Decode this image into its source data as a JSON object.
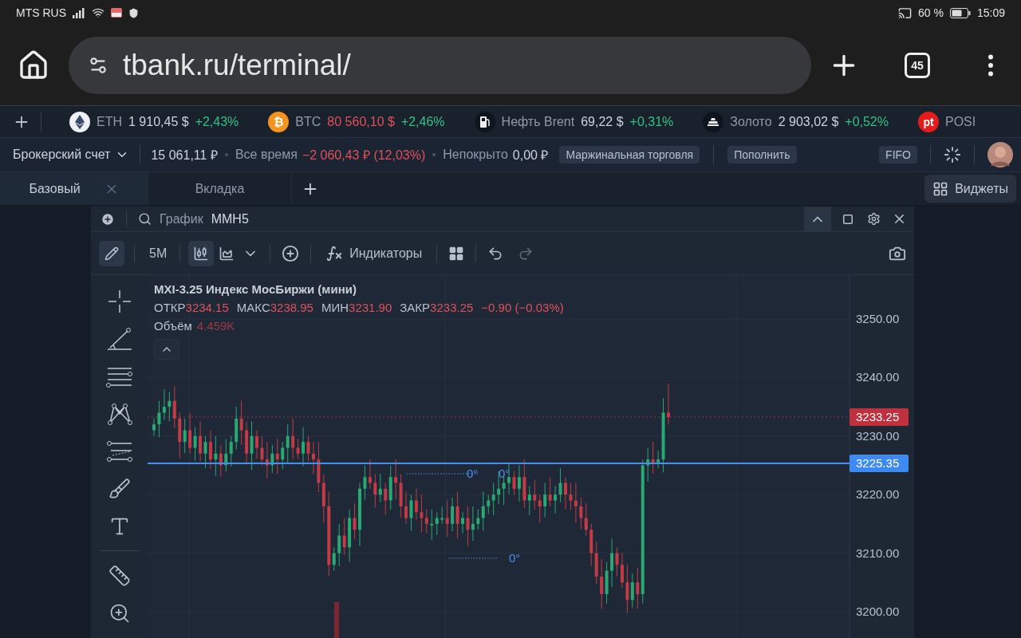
{
  "status_bar": {
    "carrier": "MTS RUS",
    "battery": "60 %",
    "time": "15:09"
  },
  "browser": {
    "url": "tbank.ru/terminal/",
    "tab_count": "45"
  },
  "ticker": [
    {
      "kind": "eth",
      "name": "ETH",
      "price": "1 910,45 $",
      "price_down": false,
      "change": "+2,43%"
    },
    {
      "kind": "btc",
      "logo_text": "₿",
      "name": "BTC",
      "price": "80 560,10 $",
      "price_down": true,
      "change": "+2,46%"
    },
    {
      "kind": "oil",
      "name": "Нефть Brent",
      "price": "69,22 $",
      "price_down": false,
      "change": "+0,31%"
    },
    {
      "kind": "gold",
      "name": "Золото",
      "price": "2 903,02 $",
      "price_down": false,
      "change": "+0,52%"
    },
    {
      "kind": "posi",
      "logo_text": "pt",
      "name": "POSI"
    }
  ],
  "account": {
    "name": "Брокерский счет",
    "balance": "15 061,11 ₽",
    "alltime_label": "Все время",
    "alltime_value": "−2 060,43 ₽ (12,03%)",
    "uncovered_label": "Непокрыто",
    "uncovered_value": "0,00 ₽",
    "chips": [
      "Маржинальная торговля",
      "Пополнить",
      "FIFO"
    ]
  },
  "tabs": [
    {
      "label": "Базовый",
      "selected": true,
      "closable": true
    },
    {
      "label": "Вкладка",
      "selected": false,
      "closable": false
    }
  ],
  "widgets_button": "Виджеты",
  "widget": {
    "title": "График",
    "ticker": "MMH5",
    "draw_mode": true,
    "interval": "5M",
    "chart_types": [
      {
        "kind": "candles",
        "selected": true
      },
      {
        "kind": "area",
        "selected": false
      }
    ],
    "indicators": "Индикаторы",
    "legend": {
      "symbol": "MXI-3.25 Индекс МосБиржи (мини)",
      "ohlc": [
        {
          "label": "ОТКР",
          "value": "3234.15"
        },
        {
          "label": "МАКС",
          "value": "3238.95"
        },
        {
          "label": "МИН",
          "value": "3231.90"
        },
        {
          "label": "ЗАКР",
          "value": "3233.25"
        }
      ],
      "change": "−0.90 (−0.03%)",
      "volume_label": "Объём",
      "volume_value": "4.459K"
    },
    "price_axis": [
      "3250.00",
      "3240.00",
      "3230.00",
      "3220.00",
      "3210.00",
      "3200.00"
    ],
    "last_price": "3233.25",
    "line_price": "3225.35",
    "angle_labels": [
      "0°",
      "0°",
      "0°"
    ]
  }
}
